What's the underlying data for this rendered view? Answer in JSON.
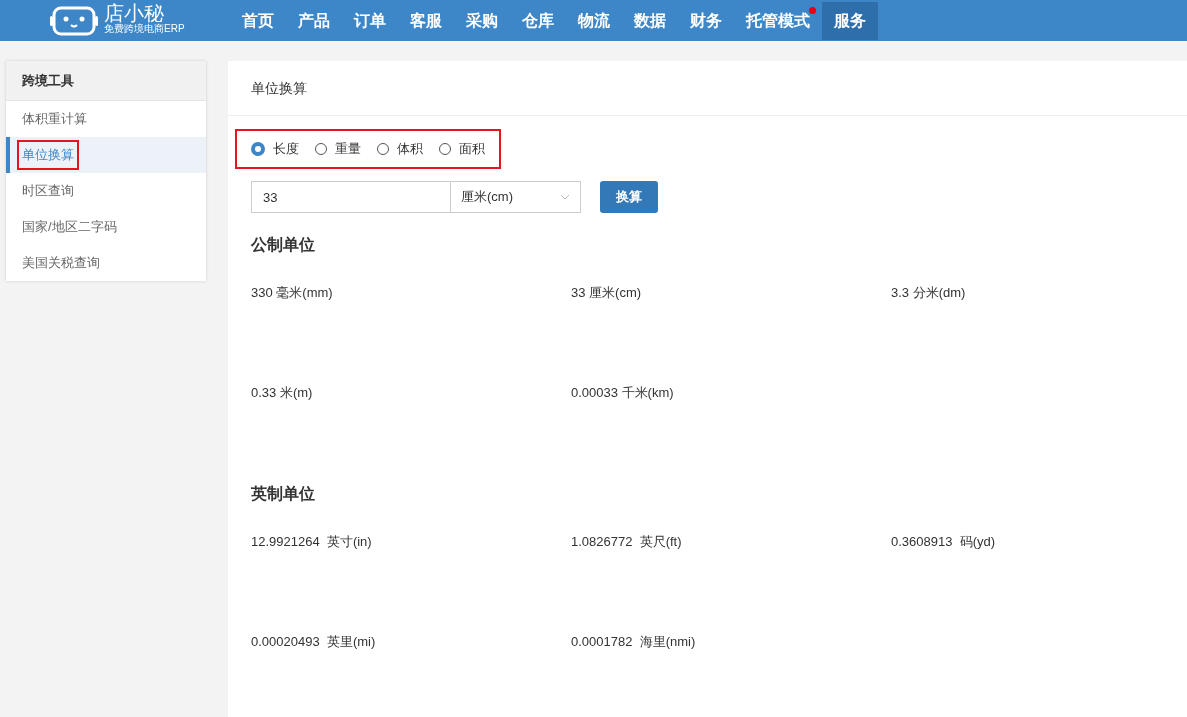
{
  "header": {
    "logo_text": "店小秘",
    "logo_tagline": "免费跨境电商ERP",
    "nav": [
      {
        "label": "首页",
        "selected": false,
        "dot": false
      },
      {
        "label": "产品",
        "selected": false,
        "dot": false
      },
      {
        "label": "订单",
        "selected": false,
        "dot": false
      },
      {
        "label": "客服",
        "selected": false,
        "dot": false
      },
      {
        "label": "采购",
        "selected": false,
        "dot": false
      },
      {
        "label": "仓库",
        "selected": false,
        "dot": false
      },
      {
        "label": "物流",
        "selected": false,
        "dot": false
      },
      {
        "label": "数据",
        "selected": false,
        "dot": false
      },
      {
        "label": "财务",
        "selected": false,
        "dot": false
      },
      {
        "label": "托管模式",
        "selected": false,
        "dot": true
      },
      {
        "label": "服务",
        "selected": true,
        "dot": false
      }
    ]
  },
  "sidebar": {
    "title": "跨境工具",
    "items": [
      {
        "label": "体积重计算",
        "selected": false,
        "highlighted": false
      },
      {
        "label": "单位换算",
        "selected": true,
        "highlighted": true
      },
      {
        "label": "时区查询",
        "selected": false,
        "highlighted": false
      },
      {
        "label": "国家/地区二字码",
        "selected": false,
        "highlighted": false
      },
      {
        "label": "美国关税查询",
        "selected": false,
        "highlighted": false
      }
    ]
  },
  "main": {
    "title": "单位换算",
    "unit_types": {
      "highlighted": true,
      "options": [
        {
          "label": "长度",
          "selected": true
        },
        {
          "label": "重量",
          "selected": false
        },
        {
          "label": "体积",
          "selected": false
        },
        {
          "label": "面积",
          "selected": false
        }
      ]
    },
    "value_input": {
      "value": "33"
    },
    "unit_select": {
      "value": "厘米(cm)"
    },
    "convert_button": "换算",
    "sections": [
      {
        "title": "公制单位",
        "results": [
          "330 毫米(mm)",
          "33 厘米(cm)",
          "3.3 分米(dm)",
          "0.33 米(m)",
          "0.00033 千米(km)"
        ]
      },
      {
        "title": "英制单位",
        "results": [
          "12.9921264  英寸(in)",
          "1.0826772  英尺(ft)",
          "0.3608913  码(yd)",
          "0.00020493  英里(mi)",
          "0.0001782  海里(nmi)"
        ]
      }
    ]
  }
}
